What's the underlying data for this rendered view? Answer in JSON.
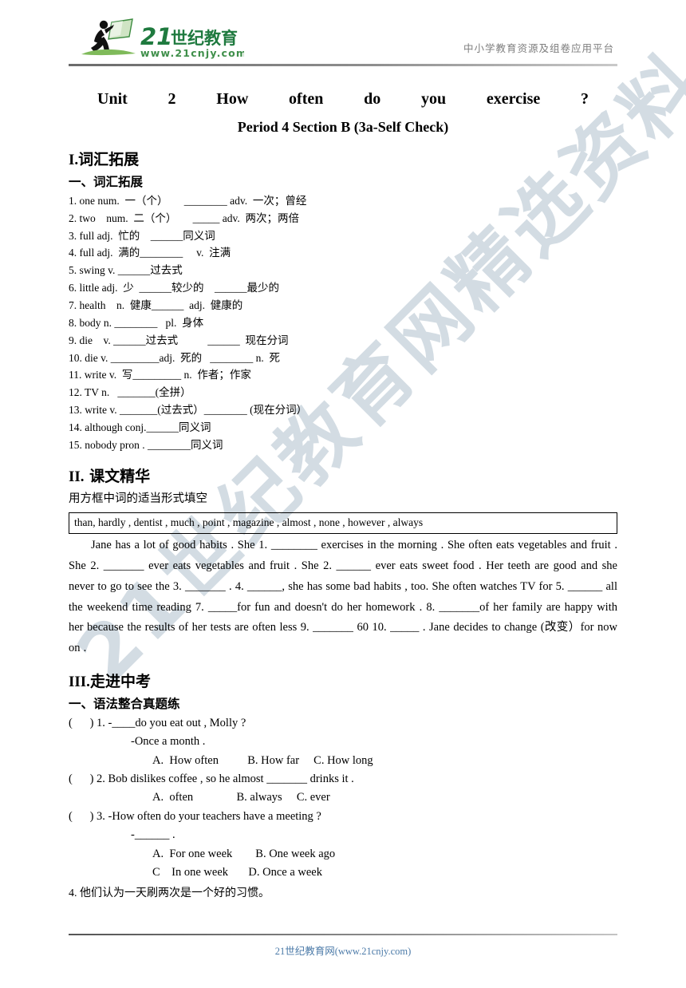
{
  "header": {
    "logo_alt": "21世纪教育",
    "logo_text_main": "21世纪教育",
    "logo_text_sub": "www.21cnjy.com",
    "right_text": "中小学教育资源及组卷应用平台"
  },
  "watermark": {
    "text": "21世纪教育网精选资料",
    "color": "#d3dce3"
  },
  "title": {
    "main": "Unit 2 How often do you exercise ?",
    "sub": "Period 4 Section B (3a-Self Check)"
  },
  "section1": {
    "heading_roman": "I.",
    "heading_cn": "词汇拓展",
    "sub_heading": "一、词汇拓展",
    "items": [
      "1. one num.  一（个）      ________ adv.  一次；曾经",
      "2. two    num.  二（个）      _____ adv.  两次；两倍",
      "3. full adj.  忙的    ______同义词",
      "4. full adj.  满的________     v.  注满",
      "5. swing v. ______过去式",
      "6. little adj.  少  ______较少的    ______最少的",
      "7. health    n.  健康______  adj.  健康的",
      "8. body n. ________   pl.  身体",
      "9. die    v. ______过去式           ______  现在分词",
      "10. die v. _________adj.  死的   ________ n.  死",
      "11. write v.  写_________ n.  作者；作家",
      "12. TV n.   _______(全拼）",
      "13. write v. _______(过去式）________ (现在分词）",
      "14. although conj.______同义词",
      "15. nobody pron . ________同义词"
    ]
  },
  "section2": {
    "heading_roman": "II.",
    "heading_cn": " 课文精华",
    "instruction": "用方框中词的适当形式填空",
    "word_bank": "than, hardly , dentist , much , point , magazine , almost , none , however , always",
    "passage": "Jane has a lot of good habits . She 1. ________ exercises in the morning . She often eats vegetables and fruit . She 2. _______ ever eats vegetables and fruit . She 2. ______ ever eats sweet food . Her teeth are good and she never to go to see the 3. _______ . 4. ______, she has some bad habits , too. She often watches TV for 5. ______ all the weekend time reading 7. _____for fun and doesn't do her homework . 8. _______of her family are happy with her because the results of her tests are often less 9. _______ 60 10. _____ . Jane decides to change (改变）for now on ."
  },
  "section3": {
    "heading_roman": "III.",
    "heading_cn": "走进中考",
    "sub_heading": "一、语法整合真题练",
    "questions": [
      {
        "stem": "(      ) 1. -____do you eat out , Molly ?",
        "reply": "-Once a month .",
        "options": "A.  How often          B. How far     C. How long"
      },
      {
        "stem": "(      ) 2. Bob dislikes coffee , so he almost _______ drinks it .",
        "reply": "",
        "options": "A.  often               B. always     C. ever"
      },
      {
        "stem": "(      ) 3. -How often do your teachers have a meeting ?",
        "reply": "-______ .",
        "options": "A.  For one week        B. One week ago",
        "options2": "C    In one week       D. Once a week"
      }
    ],
    "translation_item": "4. 他们认为一天刷两次是一个好的习惯。"
  },
  "footer": {
    "text": "21世纪教育网(www.21cnjy.com)",
    "color": "#4b7aa8"
  }
}
